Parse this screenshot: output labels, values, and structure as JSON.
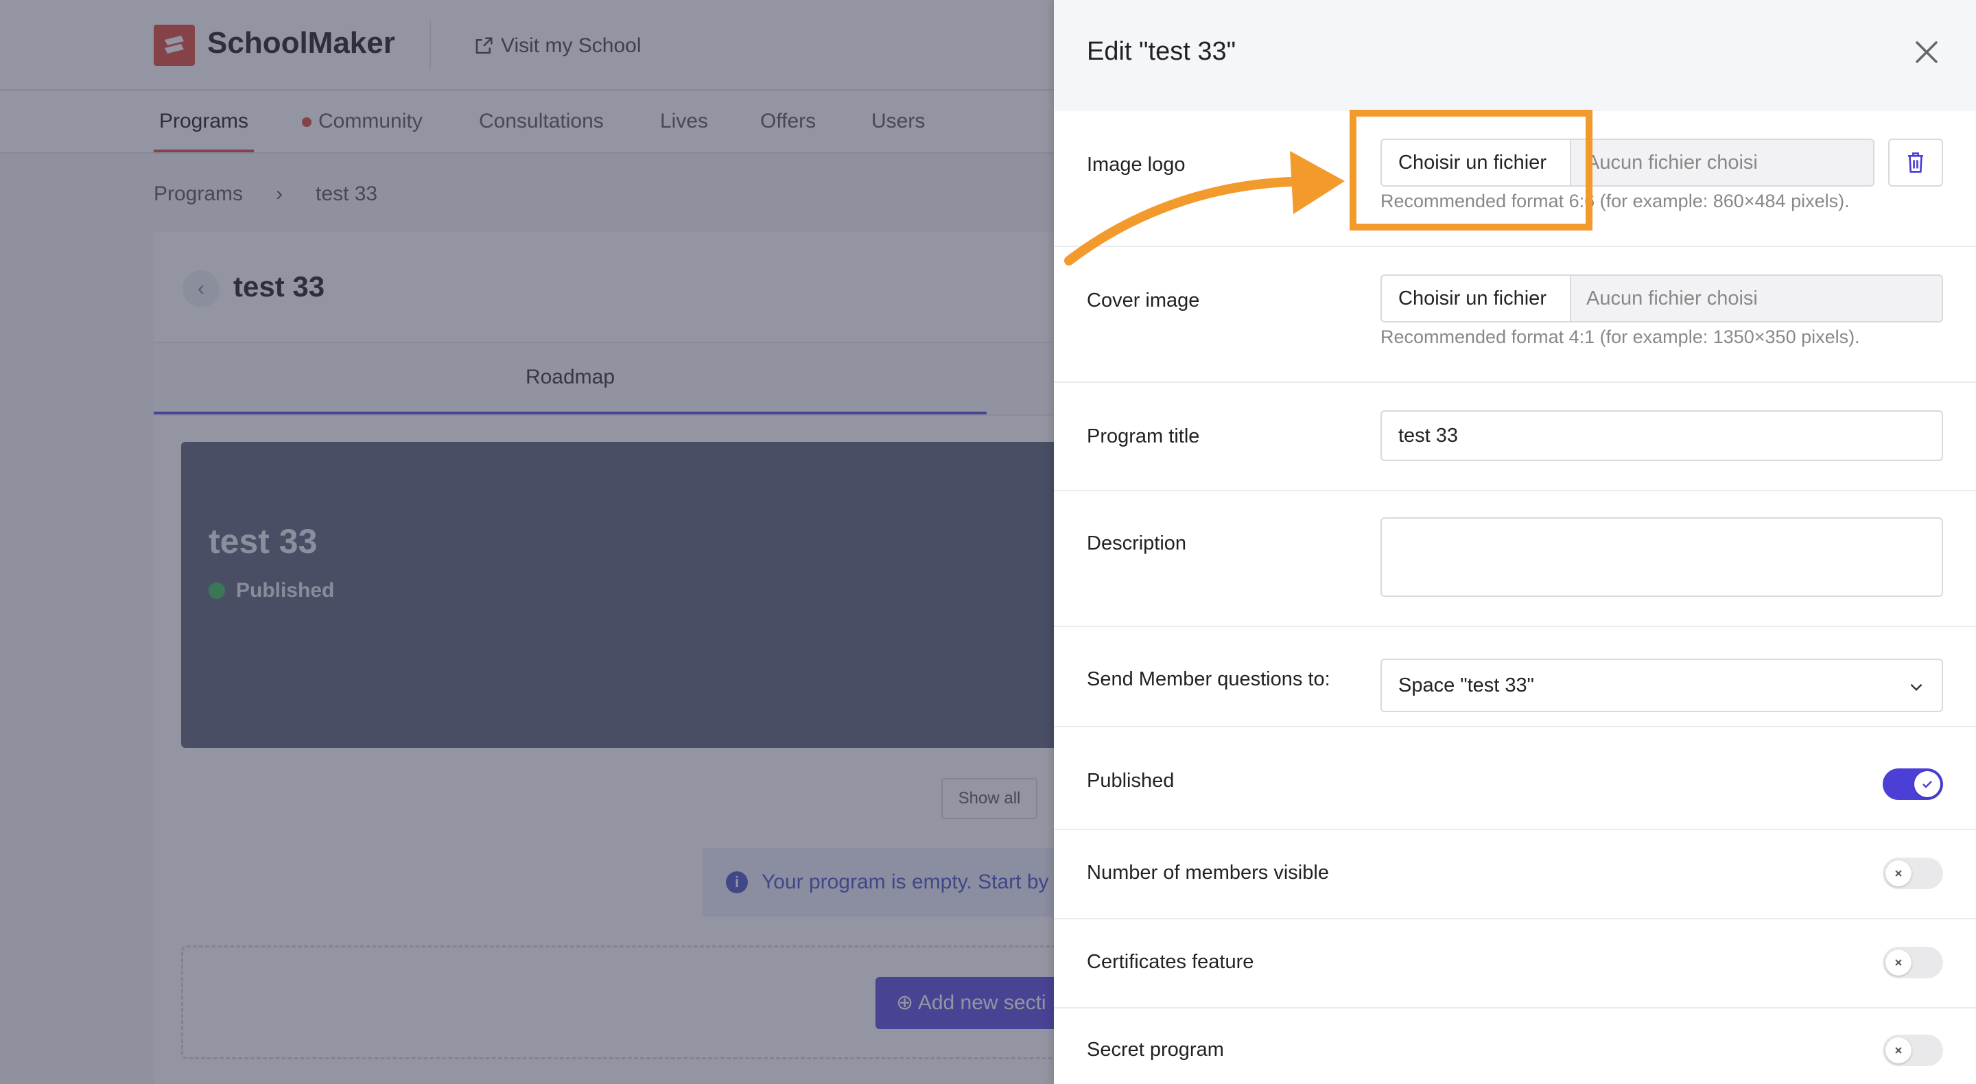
{
  "app": {
    "brand": "SchoolMaker",
    "visit_link": "Visit my School",
    "nav": [
      "Programs",
      "Community",
      "Consultations",
      "Lives",
      "Offers",
      "Users"
    ],
    "breadcrumb": {
      "root": "Programs",
      "separator": "›",
      "current": "test 33"
    },
    "program_title": "test 33",
    "tab_roadmap": "Roadmap",
    "hero": {
      "title": "test 33",
      "status": "Published"
    },
    "show_all": "Show all",
    "empty_note": "Your program is empty. Start by",
    "add_section": "Add new secti"
  },
  "panel": {
    "title": "Edit \"test 33\"",
    "image_logo": {
      "label": "Image logo",
      "button": "Choisir un fichier",
      "file_name": "Aucun fichier choisi",
      "hint": "Recommended format 6:6 (for example: 860×484 pixels)."
    },
    "cover_image": {
      "label": "Cover image",
      "button": "Choisir un fichier",
      "file_name": "Aucun fichier choisi",
      "hint": "Recommended format 4:1 (for example: 1350×350 pixels)."
    },
    "program_title": {
      "label": "Program title",
      "value": "test 33"
    },
    "description": {
      "label": "Description",
      "value": ""
    },
    "member_questions": {
      "label": "Send Member questions to:",
      "value": "Space \"test 33\""
    },
    "published": {
      "label": "Published",
      "on": true
    },
    "members_visible": {
      "label": "Number of members visible",
      "on": false
    },
    "certificates": {
      "label": "Certificates feature",
      "on": false
    },
    "secret": {
      "label": "Secret program",
      "on": false
    }
  },
  "colors": {
    "accent": "#4b3fd6",
    "annotation": "#f39a2c",
    "brand_red": "#e4584c"
  }
}
